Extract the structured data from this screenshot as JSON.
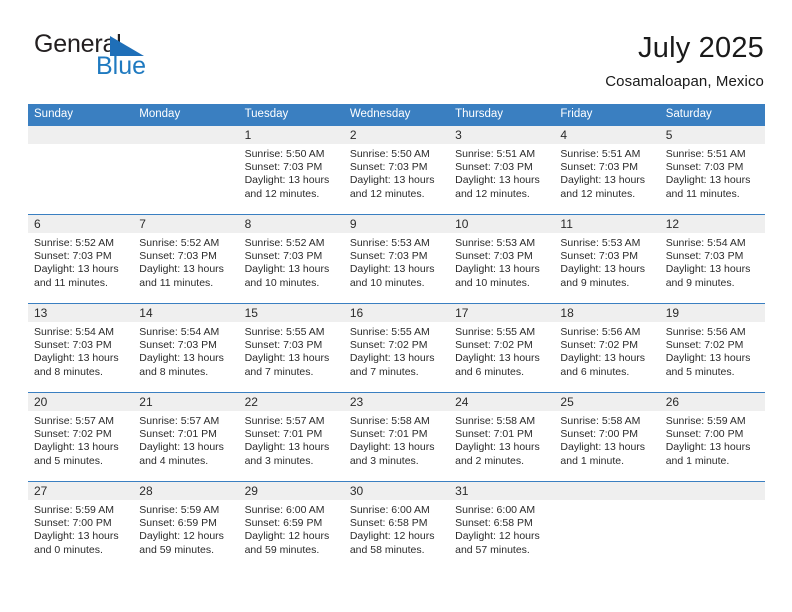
{
  "brand": {
    "name_part1": "General",
    "name_part2": "Blue",
    "triangle_icon": "triangle-icon",
    "color_dark": "#231f20",
    "color_blue": "#1f7ac0"
  },
  "header": {
    "title": "July 2025",
    "subtitle": "Cosamaloapan, Mexico"
  },
  "theme": {
    "header_blue": "#3a7fc1",
    "daynum_band": "#efefef",
    "text": "#2b2b2b"
  },
  "weekdays": [
    "Sunday",
    "Monday",
    "Tuesday",
    "Wednesday",
    "Thursday",
    "Friday",
    "Saturday"
  ],
  "weeks": [
    [
      {
        "day": "",
        "sunrise": "",
        "sunset": "",
        "daylight": ""
      },
      {
        "day": "",
        "sunrise": "",
        "sunset": "",
        "daylight": ""
      },
      {
        "day": "1",
        "sunrise": "Sunrise: 5:50 AM",
        "sunset": "Sunset: 7:03 PM",
        "daylight": "Daylight: 13 hours and 12 minutes."
      },
      {
        "day": "2",
        "sunrise": "Sunrise: 5:50 AM",
        "sunset": "Sunset: 7:03 PM",
        "daylight": "Daylight: 13 hours and 12 minutes."
      },
      {
        "day": "3",
        "sunrise": "Sunrise: 5:51 AM",
        "sunset": "Sunset: 7:03 PM",
        "daylight": "Daylight: 13 hours and 12 minutes."
      },
      {
        "day": "4",
        "sunrise": "Sunrise: 5:51 AM",
        "sunset": "Sunset: 7:03 PM",
        "daylight": "Daylight: 13 hours and 12 minutes."
      },
      {
        "day": "5",
        "sunrise": "Sunrise: 5:51 AM",
        "sunset": "Sunset: 7:03 PM",
        "daylight": "Daylight: 13 hours and 11 minutes."
      }
    ],
    [
      {
        "day": "6",
        "sunrise": "Sunrise: 5:52 AM",
        "sunset": "Sunset: 7:03 PM",
        "daylight": "Daylight: 13 hours and 11 minutes."
      },
      {
        "day": "7",
        "sunrise": "Sunrise: 5:52 AM",
        "sunset": "Sunset: 7:03 PM",
        "daylight": "Daylight: 13 hours and 11 minutes."
      },
      {
        "day": "8",
        "sunrise": "Sunrise: 5:52 AM",
        "sunset": "Sunset: 7:03 PM",
        "daylight": "Daylight: 13 hours and 10 minutes."
      },
      {
        "day": "9",
        "sunrise": "Sunrise: 5:53 AM",
        "sunset": "Sunset: 7:03 PM",
        "daylight": "Daylight: 13 hours and 10 minutes."
      },
      {
        "day": "10",
        "sunrise": "Sunrise: 5:53 AM",
        "sunset": "Sunset: 7:03 PM",
        "daylight": "Daylight: 13 hours and 10 minutes."
      },
      {
        "day": "11",
        "sunrise": "Sunrise: 5:53 AM",
        "sunset": "Sunset: 7:03 PM",
        "daylight": "Daylight: 13 hours and 9 minutes."
      },
      {
        "day": "12",
        "sunrise": "Sunrise: 5:54 AM",
        "sunset": "Sunset: 7:03 PM",
        "daylight": "Daylight: 13 hours and 9 minutes."
      }
    ],
    [
      {
        "day": "13",
        "sunrise": "Sunrise: 5:54 AM",
        "sunset": "Sunset: 7:03 PM",
        "daylight": "Daylight: 13 hours and 8 minutes."
      },
      {
        "day": "14",
        "sunrise": "Sunrise: 5:54 AM",
        "sunset": "Sunset: 7:03 PM",
        "daylight": "Daylight: 13 hours and 8 minutes."
      },
      {
        "day": "15",
        "sunrise": "Sunrise: 5:55 AM",
        "sunset": "Sunset: 7:03 PM",
        "daylight": "Daylight: 13 hours and 7 minutes."
      },
      {
        "day": "16",
        "sunrise": "Sunrise: 5:55 AM",
        "sunset": "Sunset: 7:02 PM",
        "daylight": "Daylight: 13 hours and 7 minutes."
      },
      {
        "day": "17",
        "sunrise": "Sunrise: 5:55 AM",
        "sunset": "Sunset: 7:02 PM",
        "daylight": "Daylight: 13 hours and 6 minutes."
      },
      {
        "day": "18",
        "sunrise": "Sunrise: 5:56 AM",
        "sunset": "Sunset: 7:02 PM",
        "daylight": "Daylight: 13 hours and 6 minutes."
      },
      {
        "day": "19",
        "sunrise": "Sunrise: 5:56 AM",
        "sunset": "Sunset: 7:02 PM",
        "daylight": "Daylight: 13 hours and 5 minutes."
      }
    ],
    [
      {
        "day": "20",
        "sunrise": "Sunrise: 5:57 AM",
        "sunset": "Sunset: 7:02 PM",
        "daylight": "Daylight: 13 hours and 5 minutes."
      },
      {
        "day": "21",
        "sunrise": "Sunrise: 5:57 AM",
        "sunset": "Sunset: 7:01 PM",
        "daylight": "Daylight: 13 hours and 4 minutes."
      },
      {
        "day": "22",
        "sunrise": "Sunrise: 5:57 AM",
        "sunset": "Sunset: 7:01 PM",
        "daylight": "Daylight: 13 hours and 3 minutes."
      },
      {
        "day": "23",
        "sunrise": "Sunrise: 5:58 AM",
        "sunset": "Sunset: 7:01 PM",
        "daylight": "Daylight: 13 hours and 3 minutes."
      },
      {
        "day": "24",
        "sunrise": "Sunrise: 5:58 AM",
        "sunset": "Sunset: 7:01 PM",
        "daylight": "Daylight: 13 hours and 2 minutes."
      },
      {
        "day": "25",
        "sunrise": "Sunrise: 5:58 AM",
        "sunset": "Sunset: 7:00 PM",
        "daylight": "Daylight: 13 hours and 1 minute."
      },
      {
        "day": "26",
        "sunrise": "Sunrise: 5:59 AM",
        "sunset": "Sunset: 7:00 PM",
        "daylight": "Daylight: 13 hours and 1 minute."
      }
    ],
    [
      {
        "day": "27",
        "sunrise": "Sunrise: 5:59 AM",
        "sunset": "Sunset: 7:00 PM",
        "daylight": "Daylight: 13 hours and 0 minutes."
      },
      {
        "day": "28",
        "sunrise": "Sunrise: 5:59 AM",
        "sunset": "Sunset: 6:59 PM",
        "daylight": "Daylight: 12 hours and 59 minutes."
      },
      {
        "day": "29",
        "sunrise": "Sunrise: 6:00 AM",
        "sunset": "Sunset: 6:59 PM",
        "daylight": "Daylight: 12 hours and 59 minutes."
      },
      {
        "day": "30",
        "sunrise": "Sunrise: 6:00 AM",
        "sunset": "Sunset: 6:58 PM",
        "daylight": "Daylight: 12 hours and 58 minutes."
      },
      {
        "day": "31",
        "sunrise": "Sunrise: 6:00 AM",
        "sunset": "Sunset: 6:58 PM",
        "daylight": "Daylight: 12 hours and 57 minutes."
      },
      {
        "day": "",
        "sunrise": "",
        "sunset": "",
        "daylight": ""
      },
      {
        "day": "",
        "sunrise": "",
        "sunset": "",
        "daylight": ""
      }
    ]
  ]
}
